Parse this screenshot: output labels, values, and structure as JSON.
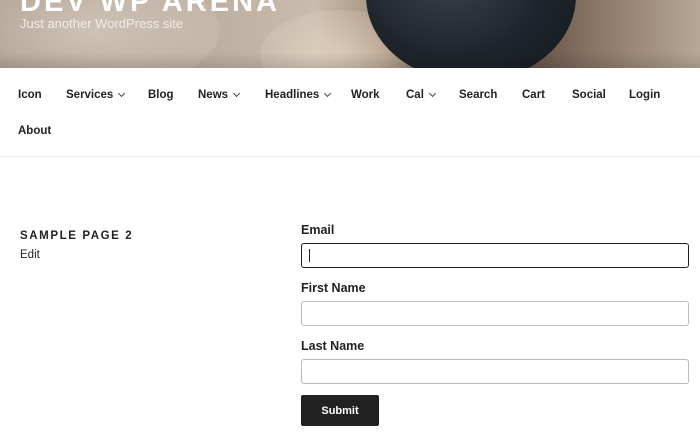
{
  "header": {
    "site_title": "DEV WP ARENA",
    "tagline": "Just another WordPress site"
  },
  "nav": {
    "items": [
      {
        "label": "Icon",
        "has_dropdown": false
      },
      {
        "label": "Services",
        "has_dropdown": true
      },
      {
        "label": "Blog",
        "has_dropdown": false
      },
      {
        "label": "News",
        "has_dropdown": true
      },
      {
        "label": "Headlines",
        "has_dropdown": true
      },
      {
        "label": "Work",
        "has_dropdown": false
      },
      {
        "label": "Cal",
        "has_dropdown": true
      },
      {
        "label": "Search",
        "has_dropdown": false
      },
      {
        "label": "Cart",
        "has_dropdown": false
      },
      {
        "label": "Social",
        "has_dropdown": false
      },
      {
        "label": "Login",
        "has_dropdown": false
      },
      {
        "label": "About",
        "has_dropdown": false
      }
    ]
  },
  "page": {
    "title": "SAMPLE PAGE 2",
    "edit_label": "Edit"
  },
  "form": {
    "email_label": "Email",
    "email_value": "",
    "first_name_label": "First Name",
    "first_name_value": "",
    "last_name_label": "Last Name",
    "last_name_value": "",
    "submit_label": "Submit"
  }
}
